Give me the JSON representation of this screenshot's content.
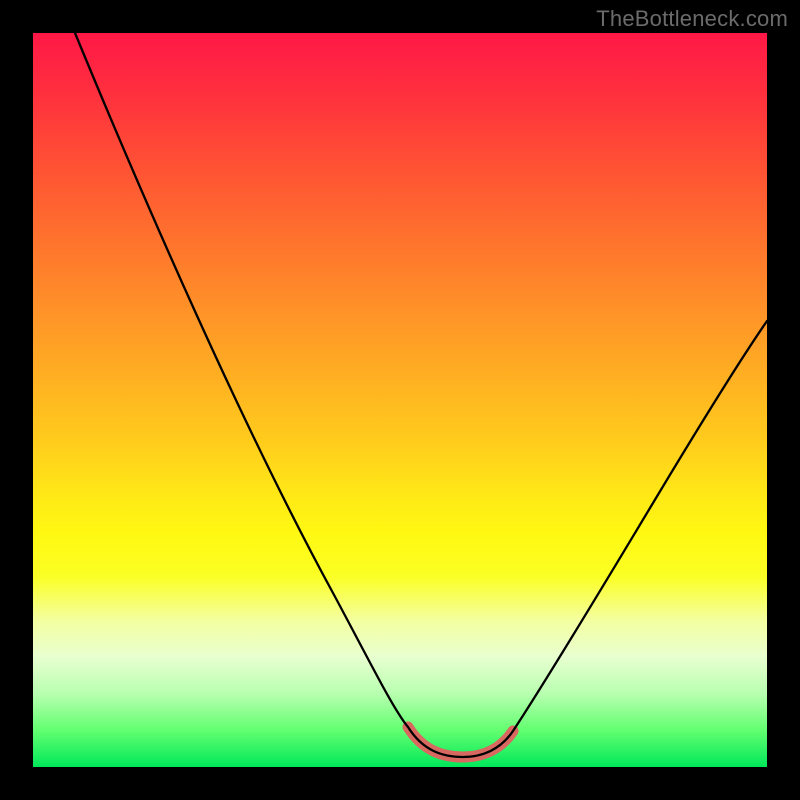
{
  "watermark": "TheBottleneck.com",
  "chart_data": {
    "type": "line",
    "title": "",
    "xlabel": "",
    "ylabel": "",
    "xlim": [
      0,
      100
    ],
    "ylim": [
      0,
      100
    ],
    "grid": false,
    "legend": false,
    "series": [
      {
        "name": "bottleneck-curve",
        "x": [
          0,
          10,
          20,
          30,
          40,
          48,
          52,
          56,
          60,
          64,
          70,
          80,
          90,
          100
        ],
        "values": [
          100,
          83,
          66,
          49,
          32,
          15,
          6,
          2,
          2,
          4,
          12,
          28,
          44,
          60
        ]
      }
    ],
    "annotations": [
      {
        "name": "valley-highlight",
        "x_range": [
          52,
          64
        ],
        "y": 2
      }
    ],
    "background_gradient": {
      "top_color": "#ff1846",
      "bottom_color": "#00e85a"
    }
  }
}
